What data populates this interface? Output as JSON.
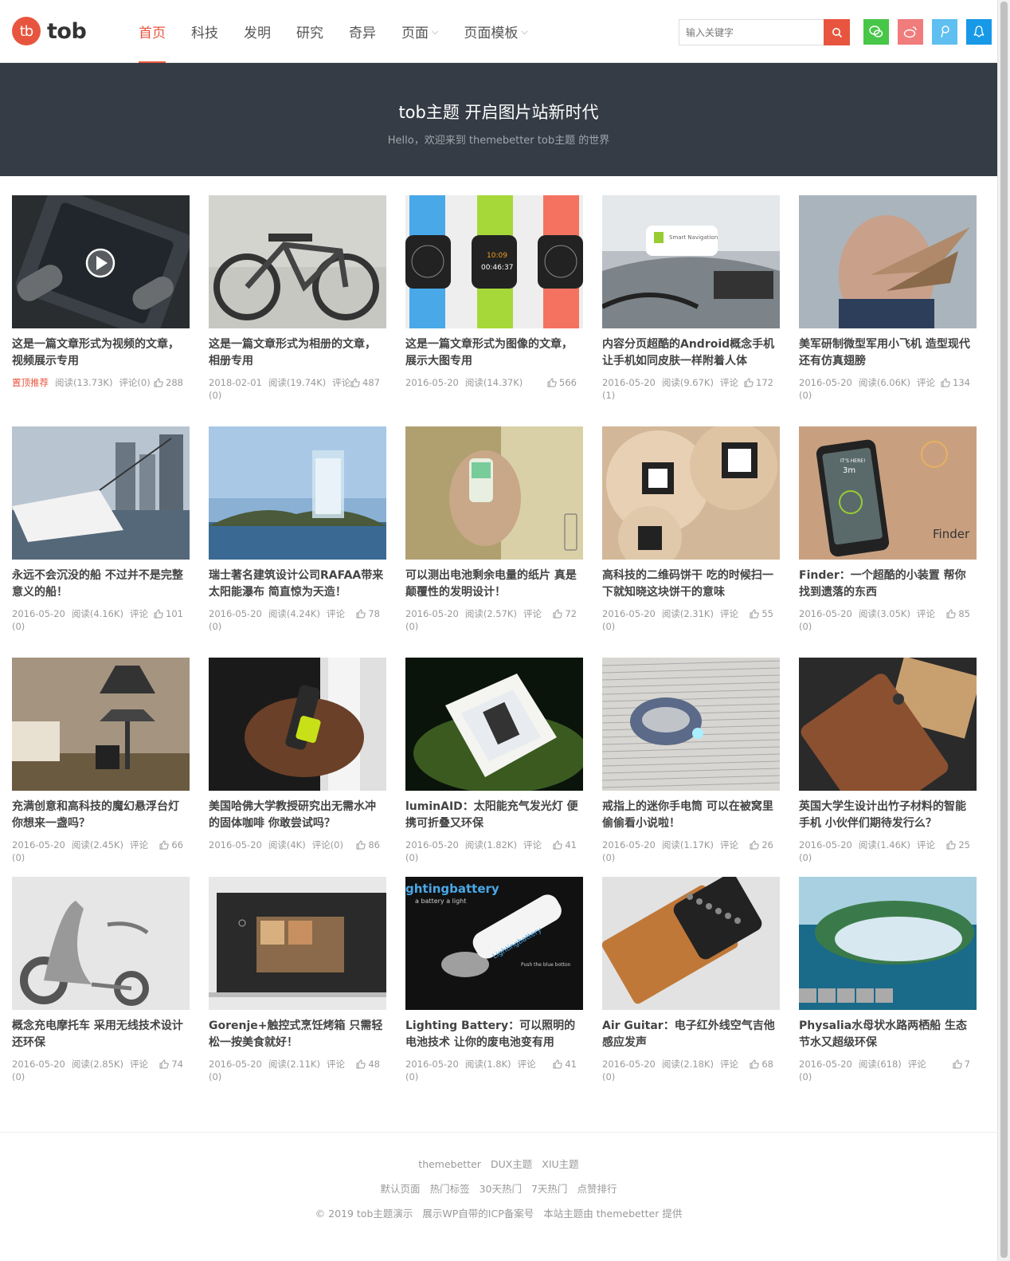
{
  "site": {
    "logo_mark": "tb",
    "logo_text": "tob"
  },
  "nav": [
    {
      "label": "首页",
      "active": true,
      "caret": ""
    },
    {
      "label": "科技",
      "active": false,
      "caret": ""
    },
    {
      "label": "发明",
      "active": false,
      "caret": ""
    },
    {
      "label": "研究",
      "active": false,
      "caret": ""
    },
    {
      "label": "奇异",
      "active": false,
      "caret": ""
    },
    {
      "label": "页面",
      "active": false,
      "caret": "⌵"
    },
    {
      "label": "页面模板",
      "active": false,
      "caret": "⌵"
    }
  ],
  "search": {
    "placeholder": "输入关键字"
  },
  "socials": [
    {
      "name": "wechat-icon",
      "color": "#48c648"
    },
    {
      "name": "weibo-icon",
      "color": "#f07c7c"
    },
    {
      "name": "tencent-weibo-icon",
      "color": "#5fbff0"
    },
    {
      "name": "qq-icon",
      "color": "#1899e8"
    }
  ],
  "banner": {
    "title": "tob主题 开启图片站新时代",
    "subtitle": "Hello，欢迎来到 themebetter tob主题 的世界"
  },
  "posts": [
    {
      "title": "这是一篇文章形式为视频的文章，视频展示专用",
      "tag": "置顶推荐",
      "date": "",
      "views": "阅读(13.73K)",
      "comments": "评论(0)",
      "likes": "288",
      "img": "bg1"
    },
    {
      "title": "这是一篇文章形式为相册的文章，相册专用",
      "tag": "",
      "date": "2018-02-01",
      "views": "阅读(19.74K)",
      "comments": "评论(0)",
      "likes": "487",
      "img": "bg2"
    },
    {
      "title": "这是一篇文章形式为图像的文章，展示大图专用",
      "tag": "",
      "date": "2016-05-20",
      "views": "阅读(14.37K)",
      "comments": "",
      "likes": "566",
      "img": "bg3"
    },
    {
      "title": "内容分页超酷的Android概念手机 让手机如同皮肤一样附着人体",
      "tag": "",
      "date": "2016-05-20",
      "views": "阅读(9.67K)",
      "comments": "评论(1)",
      "likes": "172",
      "img": "bg4"
    },
    {
      "title": "美军研制微型军用小飞机 造型现代还有仿真翅膀",
      "tag": "",
      "date": "2016-05-20",
      "views": "阅读(6.06K)",
      "comments": "评论(0)",
      "likes": "134",
      "img": "bg5"
    },
    {
      "title": "永远不会沉没的船 不过并不是完整意义的船！",
      "tag": "",
      "date": "2016-05-20",
      "views": "阅读(4.16K)",
      "comments": "评论(0)",
      "likes": "101",
      "img": "bg6"
    },
    {
      "title": "瑞士著名建筑设计公司RAFAA带来太阳能瀑布 简直惊为天造！",
      "tag": "",
      "date": "2016-05-20",
      "views": "阅读(4.24K)",
      "comments": "评论(0)",
      "likes": "78",
      "img": "bg7"
    },
    {
      "title": "可以测出电池剩余电量的纸片 真是颠覆性的发明设计！",
      "tag": "",
      "date": "2016-05-20",
      "views": "阅读(2.57K)",
      "comments": "评论(0)",
      "likes": "72",
      "img": "bg8"
    },
    {
      "title": "高科技的二维码饼干 吃的时候扫一下就知晓这块饼干的意味",
      "tag": "",
      "date": "2016-05-20",
      "views": "阅读(2.31K)",
      "comments": "评论(0)",
      "likes": "55",
      "img": "bg9"
    },
    {
      "title": "Finder：一个超酷的小装置 帮你找到遗落的东西",
      "tag": "",
      "date": "2016-05-20",
      "views": "阅读(3.05K)",
      "comments": "评论(0)",
      "likes": "85",
      "img": "bg10"
    },
    {
      "title": "充满创意和高科技的魔幻悬浮台灯 你想来一盏吗？",
      "tag": "",
      "date": "2016-05-20",
      "views": "阅读(2.45K)",
      "comments": "评论(0)",
      "likes": "66",
      "img": "bg11"
    },
    {
      "title": "美国哈佛大学教授研究出无需水冲的固体咖啡 你敢尝试吗？",
      "tag": "",
      "date": "2016-05-20",
      "views": "阅读(4K)",
      "comments": "评论(0)",
      "likes": "86",
      "img": "bg12"
    },
    {
      "title": "luminAID：太阳能充气发光灯 便携可折叠又环保",
      "tag": "",
      "date": "2016-05-20",
      "views": "阅读(1.82K)",
      "comments": "评论(0)",
      "likes": "41",
      "img": "bg13"
    },
    {
      "title": "戒指上的迷你手电筒 可以在被窝里偷偷看小说啦！",
      "tag": "",
      "date": "2016-05-20",
      "views": "阅读(1.17K)",
      "comments": "评论(0)",
      "likes": "26",
      "img": "bg14"
    },
    {
      "title": "英国大学生设计出竹子材料的智能手机 小伙伴们期待发行么？",
      "tag": "",
      "date": "2016-05-20",
      "views": "阅读(1.46K)",
      "comments": "评论(0)",
      "likes": "25",
      "img": "bg15"
    },
    {
      "title": "概念充电摩托车 采用无线技术设计还环保",
      "tag": "",
      "date": "2016-05-20",
      "views": "阅读(2.85K)",
      "comments": "评论(0)",
      "likes": "74",
      "img": "bg16"
    },
    {
      "title": "Gorenje+触控式烹饪烤箱 只需轻松一按美食就好！",
      "tag": "",
      "date": "2016-05-20",
      "views": "阅读(2.11K)",
      "comments": "评论(0)",
      "likes": "48",
      "img": "bg17"
    },
    {
      "title": "Lighting Battery：可以照明的电池技术 让你的废电池变有用",
      "tag": "",
      "date": "2016-05-20",
      "views": "阅读(1.8K)",
      "comments": "评论(0)",
      "likes": "41",
      "img": "bg18"
    },
    {
      "title": "Air Guitar：电子红外线空气吉他感应发声",
      "tag": "",
      "date": "2016-05-20",
      "views": "阅读(2.18K)",
      "comments": "评论(0)",
      "likes": "68",
      "img": "bg19"
    },
    {
      "title": "Physalia水母状水路两栖船 生态节水又超级环保",
      "tag": "",
      "date": "2016-05-20",
      "views": "阅读(618)",
      "comments": "评论(0)",
      "likes": "7",
      "img": "bg20"
    }
  ],
  "image_text": {
    "nav_sign": "Smart Navigation",
    "watch_time": "10:09",
    "watch_timer": "00:46:37",
    "finder_label": "Finder",
    "finder_distance": "3m",
    "finder_here": "IT'S HERE!",
    "battery_heading": "ghtingbattery",
    "battery_sub": "a battery a light",
    "battery_brand": "Lightingbattery",
    "battery_hint": "Push the blue botton"
  },
  "footer": {
    "row1": [
      "themebetter",
      "DUX主题",
      "XIU主题"
    ],
    "row2": [
      "默认页面",
      "热门标签",
      "30天热门",
      "7天热门",
      "点赞排行"
    ],
    "row3": [
      "© 2019 tob主题演示",
      "展示WP自带的ICP备案号",
      "本站主题由 themebetter 提供"
    ]
  }
}
